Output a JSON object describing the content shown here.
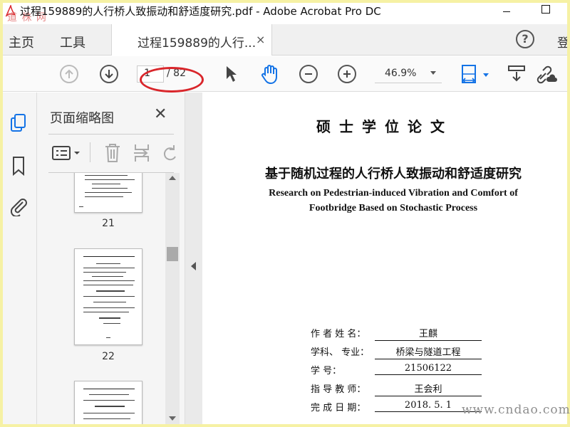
{
  "window": {
    "title": "过程159889的人行桥人致振动和舒适度研究.pdf - Adobe Acrobat Pro DC",
    "watermark_top": "道 株 网",
    "watermark_bottom": "www.cndao.com"
  },
  "menu": {
    "home": "主页",
    "tools": "工具",
    "doc_tab": "过程159889的人行...",
    "tab_close": "×",
    "help": "?",
    "signin": "登"
  },
  "toolbar": {
    "current_page": "1",
    "total_pages": "/ 82",
    "zoom": "46.9%",
    "annotation_color": "#d9262b",
    "accent_color": "#1473e6"
  },
  "panel": {
    "title": "页面缩略图",
    "close": "✕",
    "thumbnails": [
      {
        "label": "21"
      },
      {
        "label": "22"
      },
      {
        "label": ""
      }
    ]
  },
  "document": {
    "thesis_type": "硕士学位论文",
    "title_cn": "基于随机过程的人行桥人致振动和舒适度研究",
    "title_en_1": "Research on Pedestrian-induced Vibration and Comfort of",
    "title_en_2": "Footbridge Based on Stochastic Process",
    "info": [
      {
        "label": "作 者 姓 名：",
        "value": "王麒"
      },
      {
        "label": "学科、 专业：",
        "value": "桥梁与隧道工程"
      },
      {
        "label": "学        号：",
        "value": "21506122"
      },
      {
        "label": "指 导 教 师：",
        "value": "王会利"
      },
      {
        "label": "完 成 日 期：",
        "value": "2018. 5. 1"
      }
    ]
  }
}
